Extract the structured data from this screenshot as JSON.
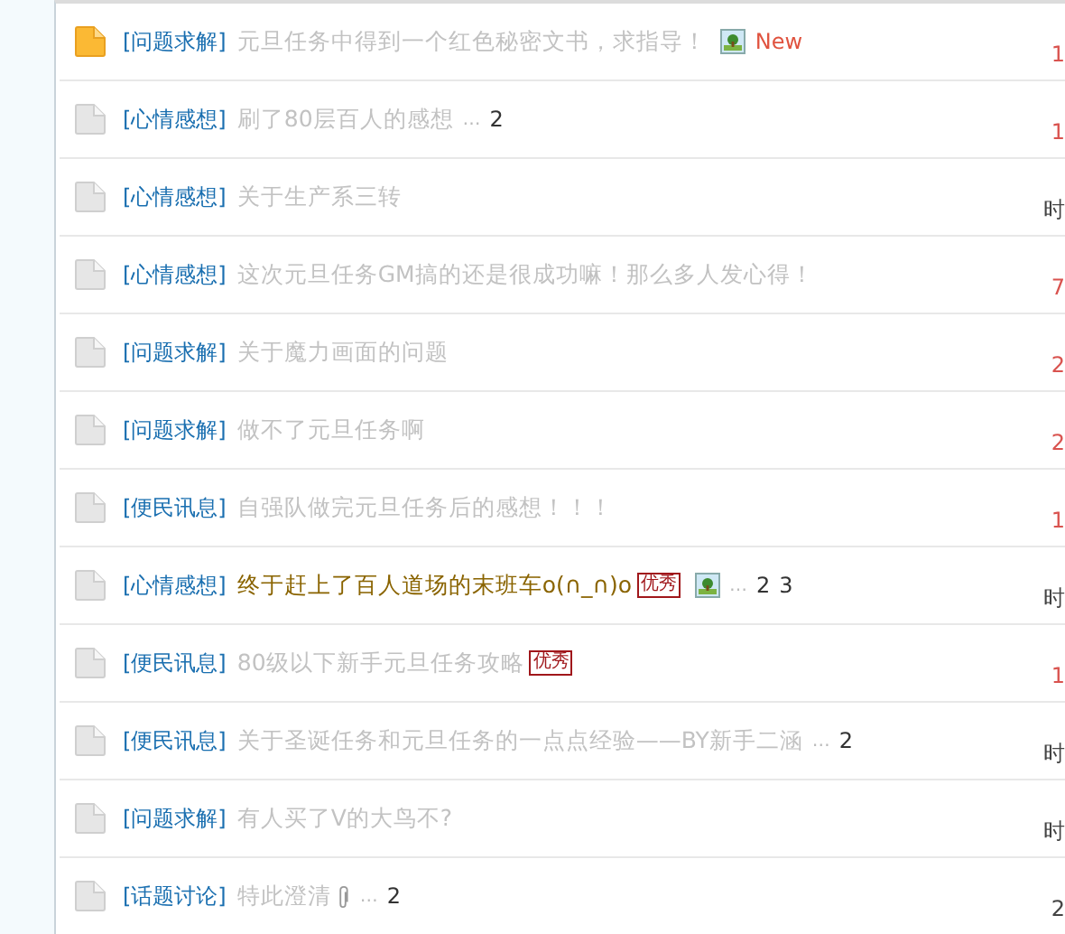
{
  "threads": [
    {
      "unread": true,
      "category": "[问题求解]",
      "title": "元旦任务中得到一个红色秘密文书，求指导！",
      "highlight": false,
      "extras": [
        {
          "kind": "image"
        },
        {
          "kind": "new",
          "text": "New"
        }
      ],
      "meta": {
        "text": "1",
        "color": "#d9534f"
      }
    },
    {
      "unread": false,
      "category": "[心情感想]",
      "title": "刷了80层百人的感想",
      "highlight": false,
      "pager": {
        "ellipsis": "…",
        "pages": [
          "2"
        ]
      },
      "meta": {
        "text": "1",
        "color": "#d9534f"
      }
    },
    {
      "unread": false,
      "category": "[心情感想]",
      "title": "关于生产系三转",
      "highlight": false,
      "meta": {
        "text": "时",
        "color": "#444444"
      }
    },
    {
      "unread": false,
      "category": "[心情感想]",
      "title": "这次元旦任务GM搞的还是很成功嘛！那么多人发心得！",
      "highlight": false,
      "meta": {
        "text": "7",
        "color": "#d9534f"
      }
    },
    {
      "unread": false,
      "category": "[问题求解]",
      "title": "关于魔力画面的问题",
      "highlight": false,
      "meta": {
        "text": "2",
        "color": "#d9534f"
      }
    },
    {
      "unread": false,
      "category": "[问题求解]",
      "title": "做不了元旦任务啊",
      "highlight": false,
      "meta": {
        "text": "2",
        "color": "#d9534f"
      }
    },
    {
      "unread": false,
      "category": "[便民讯息]",
      "title": "自强队做完元旦任务后的感想！！！",
      "highlight": false,
      "meta": {
        "text": "1",
        "color": "#d9534f"
      }
    },
    {
      "unread": false,
      "category": "[心情感想]",
      "title": "终于赶上了百人道场的末班车o(∩_∩)o",
      "highlight": true,
      "extras": [
        {
          "kind": "award",
          "text": "优秀"
        },
        {
          "kind": "image"
        }
      ],
      "pager": {
        "ellipsis": "…",
        "pages": [
          "2",
          "3"
        ]
      },
      "meta": {
        "text": "时",
        "color": "#444444"
      }
    },
    {
      "unread": false,
      "category": "[便民讯息]",
      "title": "80级以下新手元旦任务攻略",
      "highlight": false,
      "extras": [
        {
          "kind": "award",
          "text": "优秀"
        }
      ],
      "meta": {
        "text": "1",
        "color": "#d9534f"
      }
    },
    {
      "unread": false,
      "category": "[便民讯息]",
      "title": "关于圣诞任务和元旦任务的一点点经验——BY新手二涵",
      "highlight": false,
      "pager": {
        "ellipsis": "…",
        "pages": [
          "2"
        ]
      },
      "meta": {
        "text": "时",
        "color": "#444444"
      }
    },
    {
      "unread": false,
      "category": "[问题求解]",
      "title": "有人买了V的大鸟不?",
      "highlight": false,
      "meta": {
        "text": "时",
        "color": "#444444"
      }
    },
    {
      "unread": false,
      "category": "[话题讨论]",
      "title": "特此澄清",
      "highlight": false,
      "extras": [
        {
          "kind": "clip"
        }
      ],
      "pager": {
        "ellipsis": "…",
        "pages": [
          "2"
        ]
      },
      "meta": {
        "text": "2",
        "color": "#444444"
      }
    }
  ]
}
